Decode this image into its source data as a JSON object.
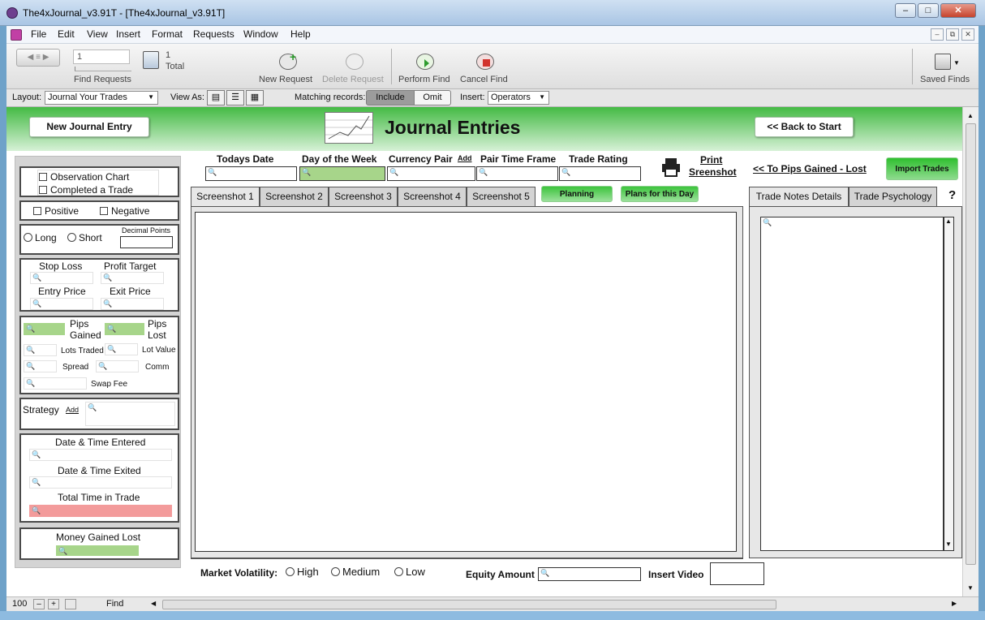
{
  "window": {
    "title": "The4xJournal_v3.91T - [The4xJournal_v3.91T]"
  },
  "menu": [
    "File",
    "Edit",
    "View",
    "Insert",
    "Format",
    "Requests",
    "Window",
    "Help"
  ],
  "toolbar": {
    "record_field": "1",
    "total_count": "1",
    "total_label": "Total",
    "find_requests": "Find Requests",
    "new_request": "New Request",
    "delete_request": "Delete Request",
    "perform_find": "Perform Find",
    "cancel_find": "Cancel Find",
    "saved_finds": "Saved Finds"
  },
  "layoutbar": {
    "layout_label": "Layout:",
    "layout_value": "Journal Your Trades",
    "view_as_label": "View As:",
    "matching_label": "Matching records:",
    "include": "Include",
    "omit": "Omit",
    "insert_label": "Insert:",
    "operators": "Operators"
  },
  "header": {
    "new_entry": "New Journal Entry",
    "title": "Journal Entries",
    "back": "<< Back to Start",
    "colors": {
      "green": "#44ba44",
      "accent_green": "#a7d58a",
      "red": "#f39b9b"
    }
  },
  "left": {
    "observation_chart": "Observation Chart",
    "completed_trade": "Completed a Trade",
    "positive": "Positive",
    "negative": "Negative",
    "long": "Long",
    "short": "Short",
    "decimal_points": "Decimal Points",
    "stop_loss": "Stop Loss",
    "profit_target": "Profit Target",
    "entry_price": "Entry Price",
    "exit_price": "Exit Price",
    "pips_gained_1": "Pips",
    "pips_gained_2": "Gained",
    "pips_lost_1": "Pips",
    "pips_lost_2": "Lost",
    "lots_traded": "Lots Traded",
    "lot_value": "Lot Value",
    "spread": "Spread",
    "comm": "Comm",
    "swap_fee": "Swap Fee",
    "strategy": "Strategy",
    "add": "Add",
    "date_entered": "Date & Time Entered",
    "date_exited": "Date & Time Exited",
    "total_time": "Total Time in Trade",
    "money": "Money Gained Lost"
  },
  "fields": {
    "todays_date": "Todays Date",
    "day_of_week": "Day of the Week",
    "currency_pair": "Currency Pair",
    "add": "Add",
    "pair_time_frame": "Pair Time Frame",
    "trade_rating": "Trade Rating",
    "print_1": "Print",
    "print_2": "Sreenshot",
    "to_pips": "<< To Pips Gained - Lost",
    "import_trades": "Import Trades"
  },
  "tabs": [
    "Screenshot 1",
    "Screenshot 2",
    "Screenshot 3",
    "Screenshot 4",
    "Screenshot 5"
  ],
  "green_buttons": {
    "planning": "Planning",
    "plans_day": "Plans for this Day"
  },
  "right_tabs": [
    "Trade Notes Details",
    "Trade Psychology"
  ],
  "help": "?",
  "bottom": {
    "market_volatility": "Market Volatility:",
    "high": "High",
    "medium": "Medium",
    "low": "Low",
    "equity_amount": "Equity Amount",
    "insert_video": "Insert Video"
  },
  "status": {
    "zoom": "100",
    "mode": "Find"
  }
}
